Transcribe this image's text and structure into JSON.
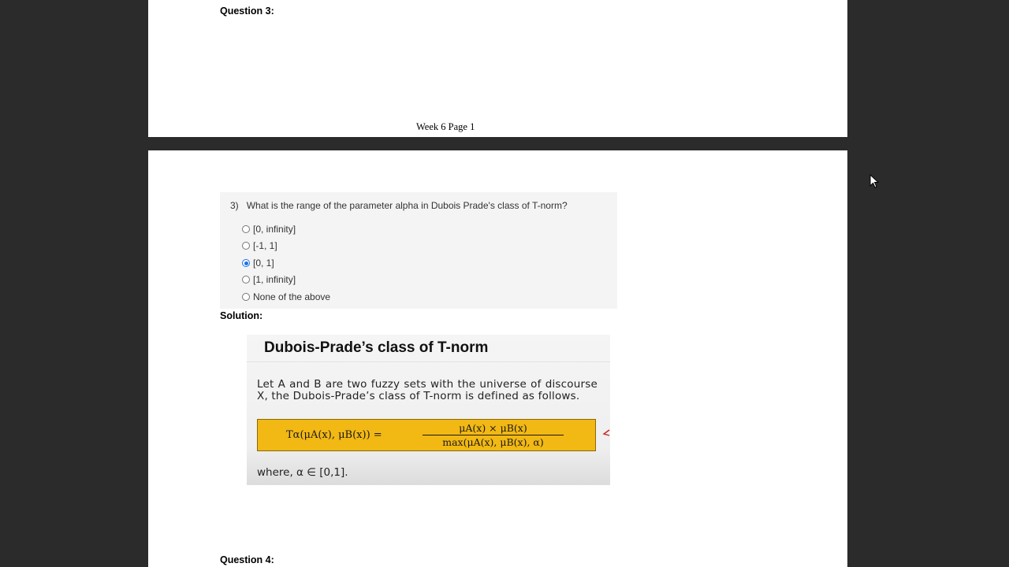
{
  "page1": {
    "question_heading": "Question 3:",
    "footer": "Week 6 Page 1"
  },
  "question": {
    "number": "3)",
    "text": "What is the range of the parameter alpha in Dubois Prade's class of T-norm?",
    "options": [
      {
        "label": "[0, infinity]",
        "selected": false
      },
      {
        "label": "[-1, 1]",
        "selected": false
      },
      {
        "label": "[0, 1]",
        "selected": true
      },
      {
        "label": "[1, infinity]",
        "selected": false
      },
      {
        "label": "None of the above",
        "selected": false
      }
    ]
  },
  "solution": {
    "label": "Solution:",
    "slide": {
      "title": "Dubois-Prade’s class of T-norm",
      "text": "Let A and B are two fuzzy sets with the universe of discourse X, the Dubois-Prade’s class of T-norm is defined as follows.",
      "formula_lhs": "Tα(μA(x), μB(x)) =",
      "formula_numerator": "μA(x) × μB(x)",
      "formula_denominator": "max(μA(x), μB(x), α)",
      "where": "where, α ∈ [0,1]."
    }
  },
  "next_question_heading": "Question 4:",
  "colors": {
    "background": "#2b2b2b",
    "formula_highlight": "#f2b814",
    "radio_selected": "#1a73e8"
  }
}
